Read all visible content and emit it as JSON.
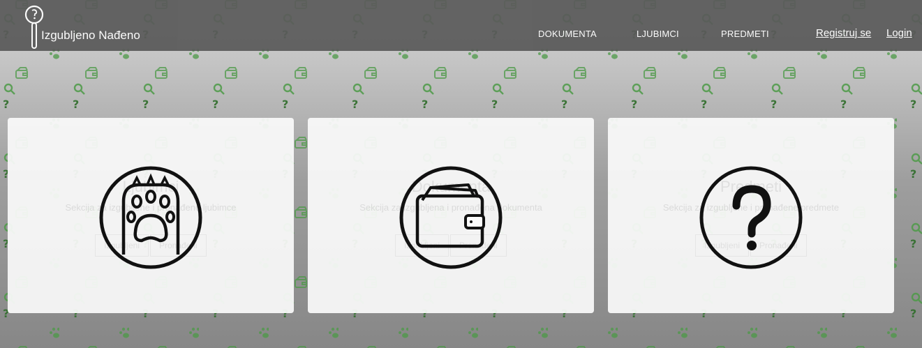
{
  "brand": {
    "name": "Izgubljeno Nađeno"
  },
  "nav": {
    "links": [
      "DOKUMENTA",
      "LJUBIMCI",
      "PREDMETI"
    ],
    "register": "Registruj se",
    "login": "Login"
  },
  "cards": [
    {
      "icon": "paw-icon",
      "title": "Ljubimci",
      "description": "Sekcija za izgubljene i pronađene ljubimce",
      "buttons": [
        "Izgubljeni",
        "Pronađeni"
      ]
    },
    {
      "icon": "wallet-icon",
      "title": "Dokumenta",
      "description": "Sekcija za izgubljena i pronađena dokumenta",
      "buttons": [
        "Izgubljeni",
        "Pronađeni"
      ]
    },
    {
      "icon": "question-icon",
      "title": "Predmeti",
      "description": "Sekcija za izgubljene i pronađene predmete",
      "buttons": [
        "Izgubljeni",
        "Pronađeni"
      ]
    }
  ],
  "colors": {
    "navbar": "#5a5a5a",
    "pattern": "#4c9a46",
    "card": "#fafafa",
    "icon": "#111111"
  }
}
